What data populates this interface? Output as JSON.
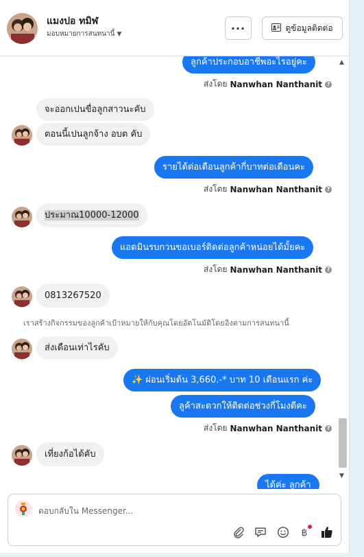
{
  "header": {
    "name": "แมงปอ ทมิฬ",
    "subtitle": "มอบหมายการสนทนานี้",
    "more_label": "···",
    "contact_info_label": "ดูข้อมูลติดต่อ"
  },
  "messages": {
    "m1": "ลูกค้าประกอบอาชีพอะไรอยู่คะ",
    "s1_prefix": "ส่งโดย",
    "s1_name": "Nanwhan Nanthanit",
    "m2": "จะออกเปนขื่อลูกสาวนะคับ",
    "m3": "ตอนนี้เปนลูกจ้าง อบต คับ",
    "m4": "รายได้ต่อเดือนลูกค้ากี่บาทต่อเดือนคะ",
    "s2_prefix": "ส่งโดย",
    "s2_name": "Nanwhan Nanthanit",
    "m5": "ประมาณ10000-12000",
    "m6": "แอดมินรบกวนขอเบอร์ติดต่อลูกค้าหน่อยได้มั้ยคะ",
    "s3_prefix": "ส่งโดย",
    "s3_name": "Nanwhan Nanthanit",
    "m7": "0813267520",
    "system_note": "เราสร้างกิจกรรมของลูกค้าเป้าหมายให้กับคุณโดยอัตโนมัติโดยอิงตามการสนทนานี้",
    "m8": "ส่งเดือนเท่าไรคับ",
    "m9": "✨ ผ่อนเริ่มต้น 3,660.-* บาท 10 เดือนแรก ค่ะ",
    "m10": "ลูค้าสะดวกให้ติดต่อช่วงกี่โมงดีคะ",
    "s4_prefix": "ส่งโดย",
    "s4_name": "Nanwhan Nanthanit",
    "m11": "เที่ยงก้อได้คับ",
    "m12": "ได้ค่ะ ลูกค้า"
  },
  "composer": {
    "placeholder": "ตอบกลับใน Messenger..."
  },
  "colors": {
    "outgoing": "#1a77f2",
    "incoming": "#f0f0f0",
    "like": "#1c1e21",
    "badge": "#e41e3f"
  }
}
